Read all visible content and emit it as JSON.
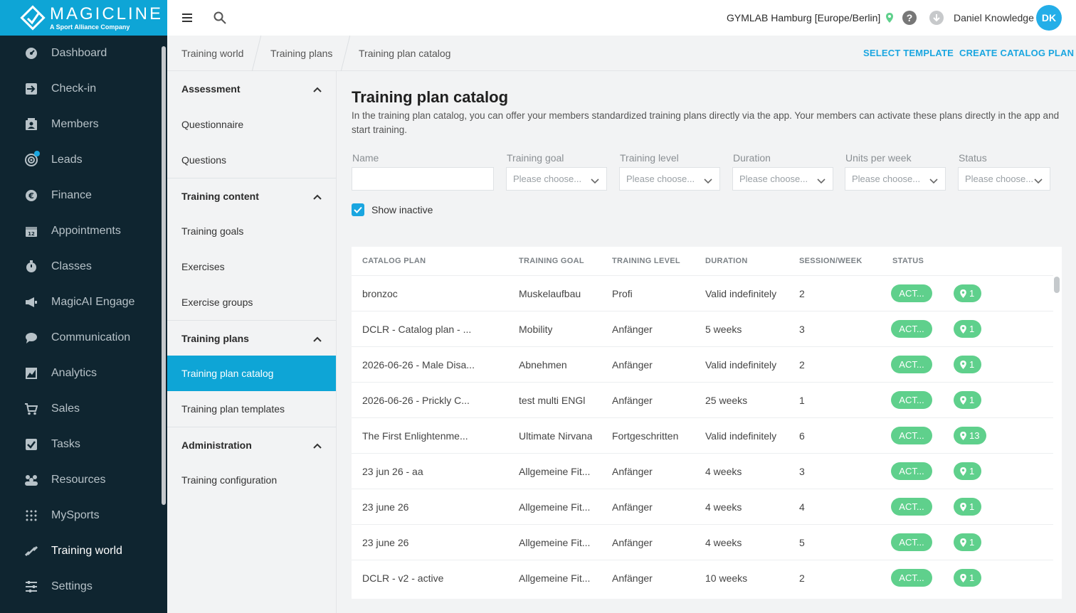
{
  "brand": {
    "title": "MAGICLINE",
    "subtitle": "A Sport Alliance Company"
  },
  "topbar": {
    "location": "GYMLAB Hamburg [Europe/Berlin]",
    "user_name": "Daniel Knowledge",
    "avatar_initials": "DK",
    "help_label": "?"
  },
  "sidebar": {
    "items": [
      {
        "label": "Dashboard",
        "icon": "dashboard-icon"
      },
      {
        "label": "Check-in",
        "icon": "check-in-icon"
      },
      {
        "label": "Members",
        "icon": "members-icon"
      },
      {
        "label": "Leads",
        "icon": "leads-icon"
      },
      {
        "label": "Finance",
        "icon": "finance-icon"
      },
      {
        "label": "Appointments",
        "icon": "calendar-icon"
      },
      {
        "label": "Classes",
        "icon": "classes-icon"
      },
      {
        "label": "MagicAI Engage",
        "icon": "megaphone-icon"
      },
      {
        "label": "Communication",
        "icon": "chat-icon"
      },
      {
        "label": "Analytics",
        "icon": "chart-icon"
      },
      {
        "label": "Sales",
        "icon": "cart-icon"
      },
      {
        "label": "Tasks",
        "icon": "checkbox-icon"
      },
      {
        "label": "Resources",
        "icon": "resources-icon"
      },
      {
        "label": "MySports",
        "icon": "dots-grid-icon"
      },
      {
        "label": "Training world",
        "icon": "dumbbell-icon"
      },
      {
        "label": "Settings",
        "icon": "sliders-icon"
      }
    ]
  },
  "breadcrumb": [
    "Training world",
    "Training plans",
    "Training plan catalog"
  ],
  "actions": {
    "select_template": "SELECT TEMPLATE",
    "create_catalog_plan": "CREATE CATALOG PLAN"
  },
  "submenu": {
    "assessment": {
      "title": "Assessment",
      "items": [
        "Questionnaire",
        "Questions"
      ]
    },
    "training_content": {
      "title": "Training content",
      "items": [
        "Training goals",
        "Exercises",
        "Exercise groups"
      ]
    },
    "training_plans": {
      "title": "Training plans",
      "items": [
        "Training plan catalog",
        "Training plan templates"
      ]
    },
    "administration": {
      "title": "Administration",
      "items": [
        "Training configuration"
      ]
    }
  },
  "page": {
    "title": "Training plan catalog",
    "description": "In the training plan catalog, you can offer your members standardized training plans directly via the app. Your members can activate these plans directly in the app and start training."
  },
  "filters": {
    "name_label": "Name",
    "name_value": "",
    "placeholder": "Please choose...",
    "training_goal": "Training goal",
    "training_level": "Training level",
    "duration": "Duration",
    "units_per_week": "Units per week",
    "status": "Status",
    "show_inactive": "Show inactive",
    "show_inactive_checked": true
  },
  "table": {
    "headers": [
      "CATALOG PLAN",
      "TRAINING GOAL",
      "TRAINING LEVEL",
      "DURATION",
      "SESSION/WEEK",
      "STATUS"
    ],
    "rows": [
      {
        "plan": "bronzoc",
        "goal": "Muskelaufbau",
        "level": "Profi",
        "duration": "Valid indefinitely",
        "sessions": "2",
        "status": "ACT...",
        "locations": "1"
      },
      {
        "plan": "DCLR - Catalog plan - ...",
        "goal": "Mobility",
        "level": "Anfänger",
        "duration": "5 weeks",
        "sessions": "3",
        "status": "ACT...",
        "locations": "1"
      },
      {
        "plan": "2026-06-26 - Male Disa...",
        "goal": "Abnehmen",
        "level": "Anfänger",
        "duration": "Valid indefinitely",
        "sessions": "2",
        "status": "ACT...",
        "locations": "1"
      },
      {
        "plan": "2026-06-26 - Prickly C...",
        "goal": "test multi ENGl",
        "level": "Anfänger",
        "duration": "25 weeks",
        "sessions": "1",
        "status": "ACT...",
        "locations": "1"
      },
      {
        "plan": "The First Enlightenme...",
        "goal": "Ultimate Nirvana",
        "level": "Fortgeschritten",
        "duration": "Valid indefinitely",
        "sessions": "6",
        "status": "ACT...",
        "locations": "13"
      },
      {
        "plan": "23 jun 26 - aa",
        "goal": "Allgemeine Fit...",
        "level": "Anfänger",
        "duration": "4 weeks",
        "sessions": "3",
        "status": "ACT...",
        "locations": "1"
      },
      {
        "plan": "23 june 26",
        "goal": "Allgemeine Fit...",
        "level": "Anfänger",
        "duration": "4 weeks",
        "sessions": "4",
        "status": "ACT...",
        "locations": "1"
      },
      {
        "plan": "23 june 26",
        "goal": "Allgemeine Fit...",
        "level": "Anfänger",
        "duration": "4 weeks",
        "sessions": "5",
        "status": "ACT...",
        "locations": "1"
      },
      {
        "plan": "DCLR - v2 - active",
        "goal": "Allgemeine Fit...",
        "level": "Anfänger",
        "duration": "10 weeks",
        "sessions": "2",
        "status": "ACT...",
        "locations": "1"
      }
    ]
  },
  "colors": {
    "brand_blue": "#0ea5d6",
    "sidebar_bg": "#0f2530",
    "link_blue": "#1aa6e0",
    "status_green": "#5fd08c"
  }
}
